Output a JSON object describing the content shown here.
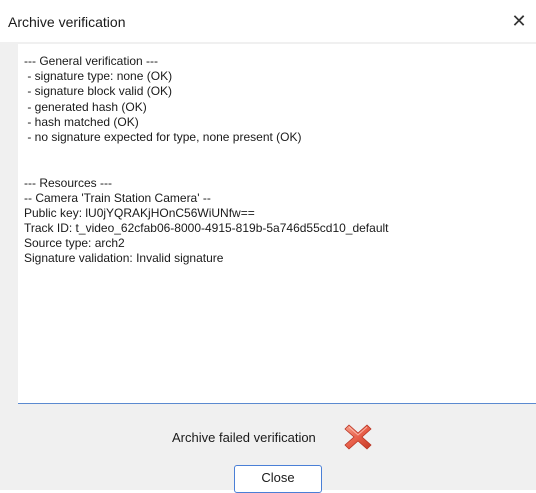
{
  "window": {
    "title": "Archive verification",
    "close_glyph": "✕"
  },
  "log": {
    "lines": [
      "--- General verification ---",
      " - signature type: none (OK)",
      " - signature block valid (OK)",
      " - generated hash (OK)",
      " - hash matched (OK)",
      " - no signature expected for type, none present (OK)",
      "",
      "",
      "--- Resources ---",
      "-- Camera 'Train Station Camera' --",
      "Public key: lU0jYQRAKjHOnC56WiUNfw==",
      "Track ID: t_video_62cfab06-8000-4915-819b-5a746d55cd10_default",
      "Source type: arch2",
      "Signature validation: Invalid signature"
    ]
  },
  "status": {
    "text": "Archive failed verification",
    "icon": "fail-cross-icon",
    "icon_color": "#e8604a"
  },
  "buttons": {
    "close_label": "Close"
  }
}
